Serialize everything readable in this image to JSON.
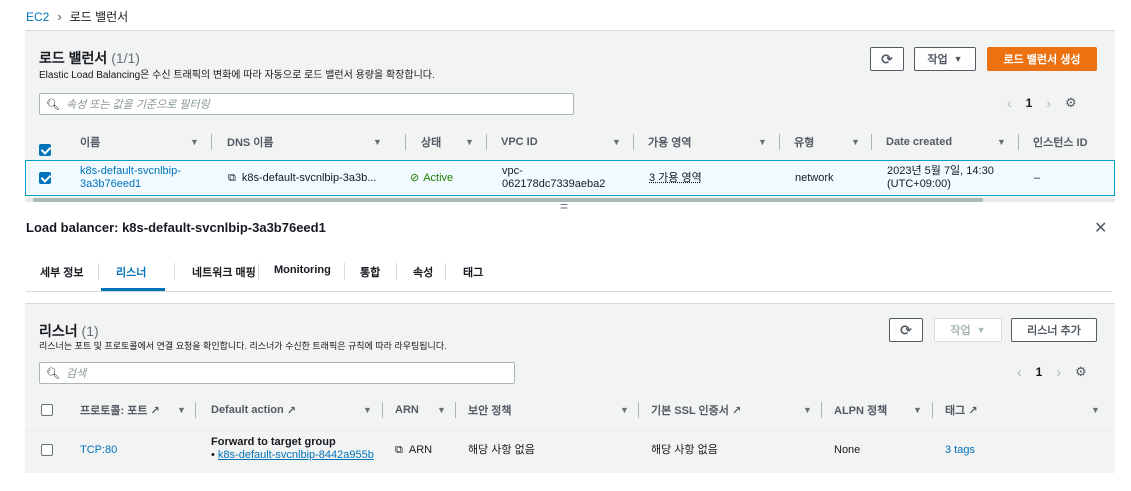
{
  "breadcrumb": {
    "root": "EC2",
    "current": "로드 밸런서"
  },
  "lb_panel": {
    "title": "로드 밸런서",
    "count": "(1/1)",
    "description": "Elastic Load Balancing은 수신 트래픽의 변화에 따라 자동으로 로드 밸런서 용량을 확장합니다.",
    "actions_label": "작업",
    "create_label": "로드 밸런서 생성",
    "search_placeholder": "속성 또는 값을 기준으로 필터링",
    "page": "1",
    "columns": [
      "이름",
      "DNS 이름",
      "상태",
      "VPC ID",
      "가용 영역",
      "유형",
      "Date created",
      "인스턴스 ID"
    ],
    "row": {
      "name_line1": "k8s-default-svcnlbip-",
      "name_line2": "3a3b76eed1",
      "dns": "k8s-default-svcnlbip-3a3b...",
      "state": "Active",
      "vpc_line1": "vpc-",
      "vpc_line2": "062178dc7339aeba2",
      "az": "3 가용 영역",
      "type": "network",
      "date_line1": "2023년 5월 7일, 14:30",
      "date_line2": "(UTC+09:00)",
      "instance": "–"
    }
  },
  "details": {
    "title": "Load balancer: k8s-default-svcnlbip-3a3b76eed1",
    "tabs": [
      "세부 정보",
      "리스너",
      "네트워크 매핑",
      "Monitoring",
      "통합",
      "속성",
      "태그"
    ],
    "active_tab": "리스너"
  },
  "listener_panel": {
    "title": "리스너",
    "count": "(1)",
    "description": "리스너는 포트 및 프로토콜에서 연결 요청을 확인합니다. 리스너가 수신한 트래픽은 규칙에 따라 라우팅됩니다.",
    "actions_label": "작업",
    "add_label": "리스너 추가",
    "search_placeholder": "검색",
    "page": "1",
    "columns": [
      "프로토콜: 포트",
      "Default action",
      "ARN",
      "보안 정책",
      "기본 SSL 인증서",
      "ALPN 정책",
      "태그"
    ],
    "row": {
      "protocol": "TCP:80",
      "action_title": "Forward to target group",
      "action_target": "k8s-default-svcnlbip-8442a955b",
      "arn": "ARN",
      "security": "해당 사항 없음",
      "ssl": "해당 사항 없음",
      "alpn": "None",
      "tags": "3 tags"
    }
  },
  "colors": {
    "link": "#0073bb",
    "primary": "#ec7211",
    "success": "#1d8102"
  }
}
